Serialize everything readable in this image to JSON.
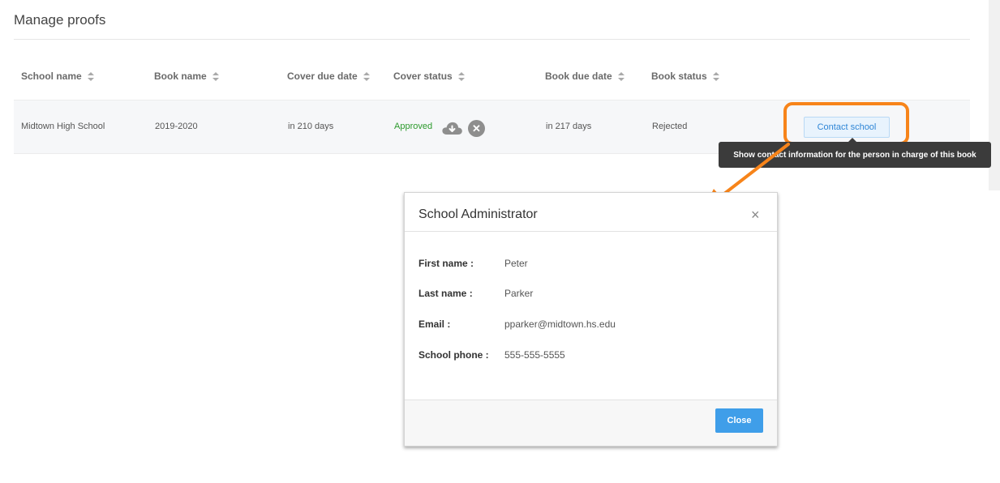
{
  "page": {
    "title": "Manage proofs"
  },
  "table": {
    "columns": [
      {
        "label": "School name"
      },
      {
        "label": "Book name"
      },
      {
        "label": "Cover due date"
      },
      {
        "label": "Cover status"
      },
      {
        "label": "Book due date"
      },
      {
        "label": "Book status"
      }
    ],
    "rows": [
      {
        "school_name": "Midtown High School",
        "book_name": "2019-2020",
        "cover_due_date": "in 210 days",
        "cover_status": "Approved",
        "book_due_date": "in 217 days",
        "book_status": "Rejected",
        "action_label": "Contact school"
      }
    ]
  },
  "tooltip": {
    "text": "Show contact information for the person in charge of this book"
  },
  "modal": {
    "title": "School Administrator",
    "close_symbol": "×",
    "fields": [
      {
        "label": "First name :",
        "value": "Peter"
      },
      {
        "label": "Last name :",
        "value": "Parker"
      },
      {
        "label": "Email :",
        "value": "pparker@midtown.hs.edu"
      },
      {
        "label": "School phone :",
        "value": "555-555-5555"
      }
    ],
    "close_button_label": "Close"
  },
  "colors": {
    "highlight": "#f7841a",
    "primary": "#3f9ee9",
    "approved": "#2c9a2c"
  },
  "icons": [
    "sort-icon",
    "cloud-download-icon",
    "reject-icon",
    "close-icon",
    "arrow-annotation-icon"
  ]
}
